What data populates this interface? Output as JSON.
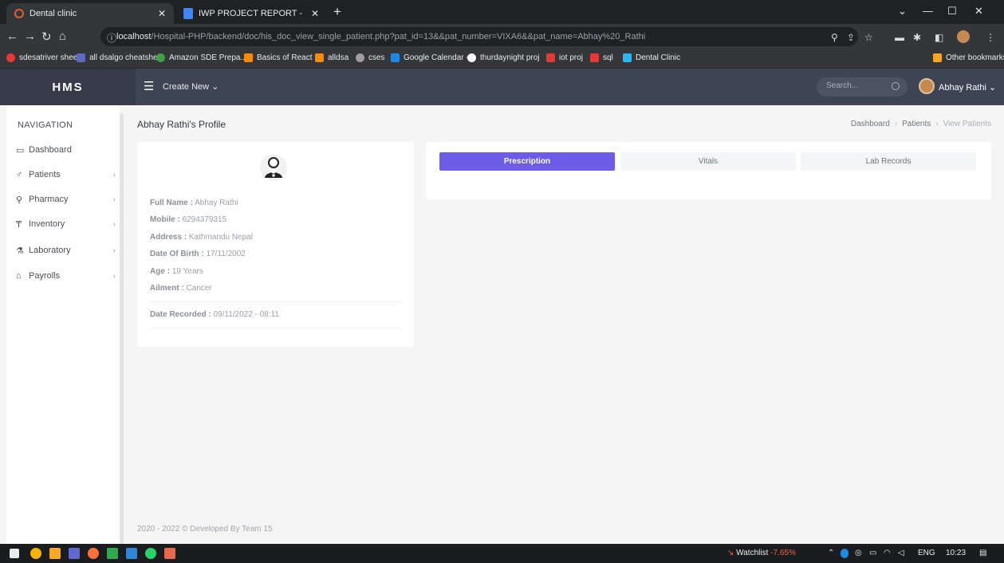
{
  "browser": {
    "tabs": [
      {
        "title": "Dental clinic",
        "active": true
      },
      {
        "title": "IWP PROJECT REPORT - Google D",
        "active": false
      }
    ],
    "url_host": "localhost",
    "url_path": "/Hospital-PHP/backend/doc/his_doc_view_single_patient.php?pat_id=13&&pat_number=VIXA6&&pat_name=Abhay%20_Rathi",
    "bookmarks": [
      {
        "label": "sdesatriver sheet",
        "color": "#e53935"
      },
      {
        "label": "all dsalgo cheatsheet",
        "color": "#5c6bc0"
      },
      {
        "label": "Amazon SDE Prepa...",
        "color": "#43a047"
      },
      {
        "label": "Basics of React",
        "color": "#fb8c00"
      },
      {
        "label": "alldsa",
        "color": "#fb8c00"
      },
      {
        "label": "cses",
        "color": "#9e9e9e"
      },
      {
        "label": "Google Calendar -...",
        "color": "#1e88e5"
      },
      {
        "label": "thurdaynight proj",
        "color": "#ffffff"
      },
      {
        "label": "iot proj",
        "color": "#e53935"
      },
      {
        "label": "sql",
        "color": "#e53935"
      },
      {
        "label": "Dental Clinic",
        "color": "#29b6f6"
      }
    ],
    "other_bookmarks": "Other bookmarks"
  },
  "header": {
    "logo": "HMS",
    "create_new": "Create New ⌄",
    "search_placeholder": "Search...",
    "user_name": "Abhay Rathi ⌄"
  },
  "sidebar": {
    "heading": "NAVIGATION",
    "items": [
      {
        "label": "Dashboard",
        "icon": "▭",
        "has_children": false
      },
      {
        "label": "Patients",
        "icon": "♂",
        "has_children": true
      },
      {
        "label": "Pharmacy",
        "icon": "⚲",
        "has_children": true
      },
      {
        "label": "Inventory",
        "icon": "₸",
        "has_children": true
      },
      {
        "label": "Laboratory",
        "icon": "⚗",
        "has_children": true
      },
      {
        "label": "Payrolls",
        "icon": "⌂",
        "has_children": true
      }
    ]
  },
  "page": {
    "title": "Abhay Rathi's Profile",
    "breadcrumb": [
      "Dashboard",
      "Patients",
      "View Patients"
    ]
  },
  "profile": {
    "full_name_label": "Full Name :",
    "full_name": "Abhay Rathi",
    "mobile_label": "Mobile :",
    "mobile": "6294379315",
    "address_label": "Address :",
    "address": "Kathmandu Nepal",
    "dob_label": "Date Of Birth :",
    "dob": "17/11/2002",
    "age_label": "Age :",
    "age": "19 Years",
    "ailment_label": "Ailment :",
    "ailment": "Cancer",
    "date_recorded_label": "Date Recorded :",
    "date_recorded": "09/11/2022 - 08:11"
  },
  "tabs": [
    {
      "label": "Prescription",
      "active": true
    },
    {
      "label": "Vitals",
      "active": false
    },
    {
      "label": "Lab Records",
      "active": false
    }
  ],
  "footer": "2020 - 2022 © Developed By Team 15",
  "taskbar": {
    "watchlist": "Watchlist",
    "watchlist_change": "-7.65%",
    "lang": "ENG",
    "time": "10:23"
  },
  "colors": {
    "header_bg": "#3d4453",
    "accent": "#6c5ce7"
  }
}
